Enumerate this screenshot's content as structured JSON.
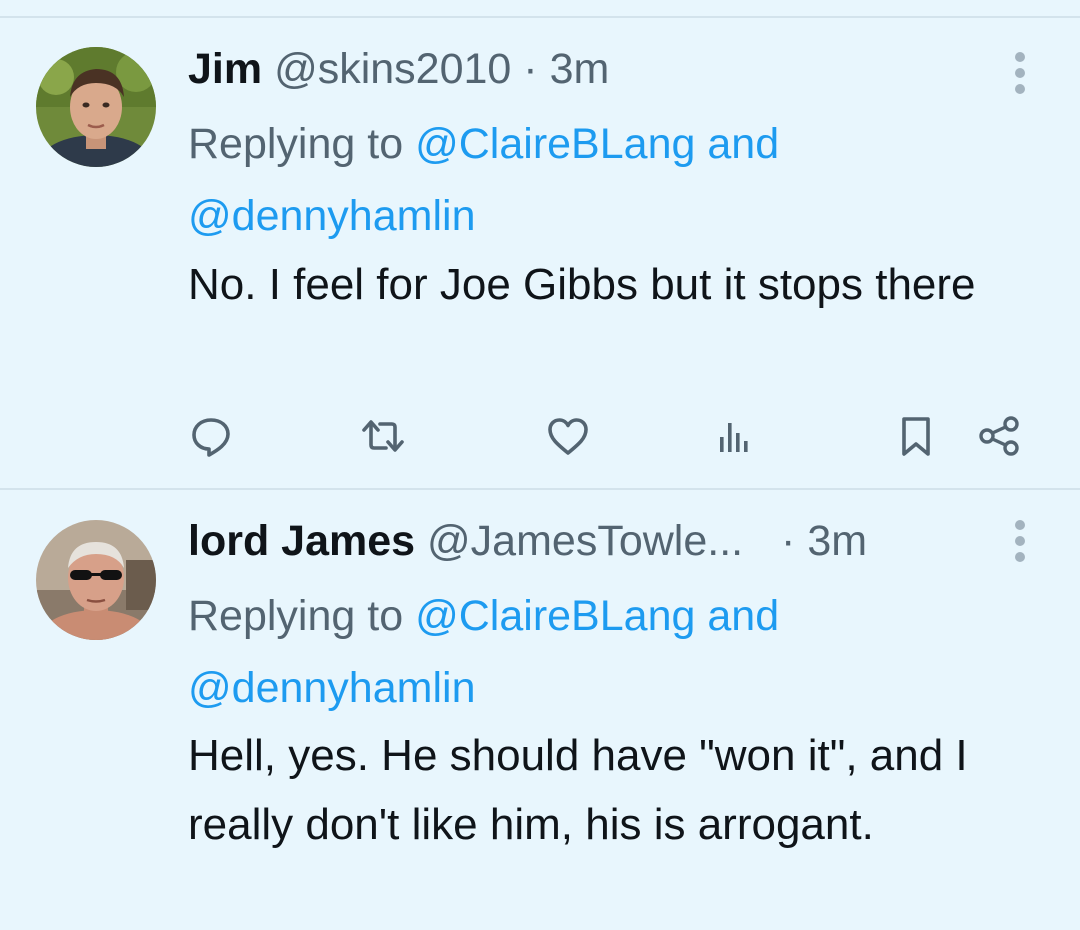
{
  "tweets": [
    {
      "display_name": "Jim",
      "handle": "@skins2010",
      "separator": "·",
      "time": "3m",
      "replying_prefix": "Replying to",
      "mentions": [
        "@ClaireBLang",
        "@dennyhamlin"
      ],
      "replying_joiner": "and",
      "text": "No.  I feel for Joe Gibbs but it stops there",
      "avatar_icon": "profile-photo-man-outdoors",
      "actions": [
        "reply-icon",
        "retweet-icon",
        "like-icon",
        "views-icon",
        "bookmark-icon",
        "share-icon"
      ]
    },
    {
      "display_name": "lord James",
      "handle": "@JamesTowle...",
      "separator": "·",
      "time": "3m",
      "replying_prefix": "Replying to",
      "mentions": [
        "@ClaireBLang",
        "@dennyhamlin"
      ],
      "replying_joiner": "and",
      "text": "Hell, yes. He should have \"won it\", and I really don't like him, his is arrogant.",
      "avatar_icon": "profile-photo-man-sunglasses"
    }
  ],
  "colors": {
    "background": "#e8f6fd",
    "text": "#0f1419",
    "secondary": "#536471",
    "link": "#1d9bf0",
    "icon": "#536471",
    "divider": "#d3e3ec"
  }
}
